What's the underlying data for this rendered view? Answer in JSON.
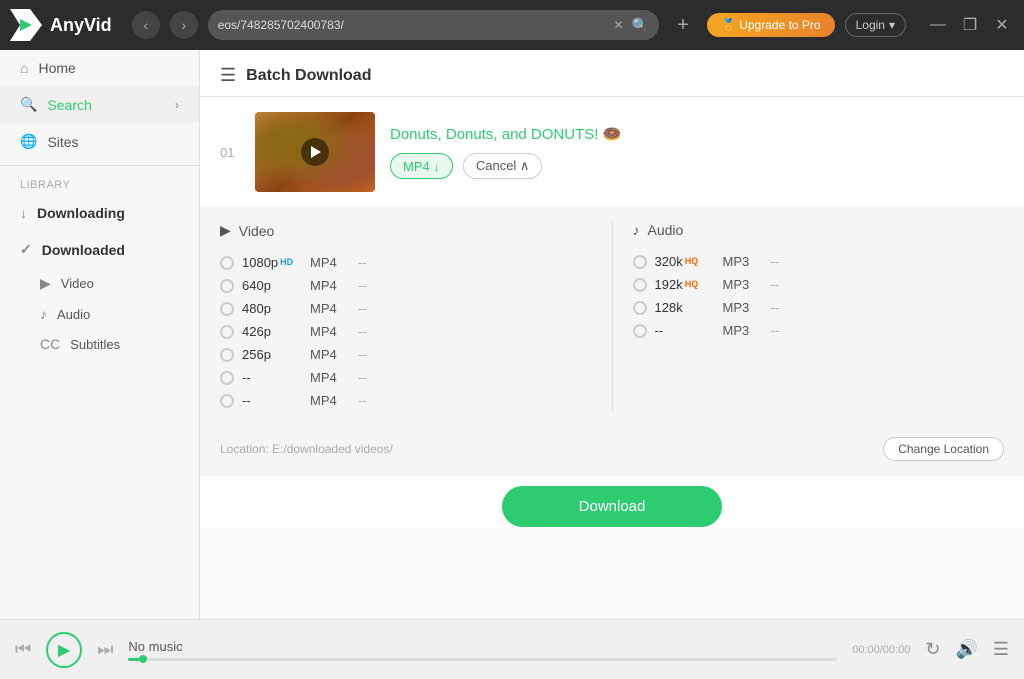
{
  "titlebar": {
    "app_name": "AnyVid",
    "url": "eos/748285702400783/",
    "upgrade_label": "🏅 Upgrade to Pro",
    "login_label": "Login",
    "nav_back": "‹",
    "nav_forward": "›",
    "add_tab": "+",
    "win_minimize": "—",
    "win_maximize": "❐",
    "win_close": "✕"
  },
  "sidebar": {
    "home_label": "Home",
    "search_label": "Search",
    "sites_label": "Sites",
    "library_label": "Library",
    "downloading_label": "Downloading",
    "downloaded_label": "Downloaded",
    "video_label": "Video",
    "audio_label": "Audio",
    "subtitles_label": "Subtitles"
  },
  "content": {
    "batch_title": "Batch Download",
    "item_number": "01",
    "video_title": "Donuts, Donuts, and DONUTS! 🍩",
    "mp4_label": "MP4 ↓",
    "cancel_label": "Cancel ∧",
    "video_section_label": "Video",
    "audio_section_label": "Audio",
    "video_options": [
      {
        "quality": "1080p",
        "badge": "HD",
        "badge_type": "hd",
        "format": "MP4",
        "size": "--"
      },
      {
        "quality": "640p",
        "badge": "",
        "badge_type": "",
        "format": "MP4",
        "size": "--"
      },
      {
        "quality": "480p",
        "badge": "",
        "badge_type": "",
        "format": "MP4",
        "size": "--"
      },
      {
        "quality": "426p",
        "badge": "",
        "badge_type": "",
        "format": "MP4",
        "size": "--"
      },
      {
        "quality": "256p",
        "badge": "",
        "badge_type": "",
        "format": "MP4",
        "size": "--"
      },
      {
        "quality": "--",
        "badge": "",
        "badge_type": "",
        "format": "MP4",
        "size": "--"
      },
      {
        "quality": "--",
        "badge": "",
        "badge_type": "",
        "format": "MP4",
        "size": "--"
      }
    ],
    "audio_options": [
      {
        "quality": "320k",
        "badge": "HQ",
        "badge_type": "hq",
        "format": "MP3",
        "size": "--"
      },
      {
        "quality": "192k",
        "badge": "HQ",
        "badge_type": "hq",
        "format": "MP3",
        "size": "--"
      },
      {
        "quality": "128k",
        "badge": "",
        "badge_type": "",
        "format": "MP3",
        "size": "--"
      },
      {
        "quality": "--",
        "badge": "",
        "badge_type": "",
        "format": "MP3",
        "size": "--"
      }
    ],
    "location_label": "Location: E:/downloaded videos/",
    "change_location_label": "Change Location",
    "download_btn_label": "Download"
  },
  "player": {
    "no_music_label": "No music",
    "time_label": "00:00/00:00",
    "progress_pct": 2
  }
}
